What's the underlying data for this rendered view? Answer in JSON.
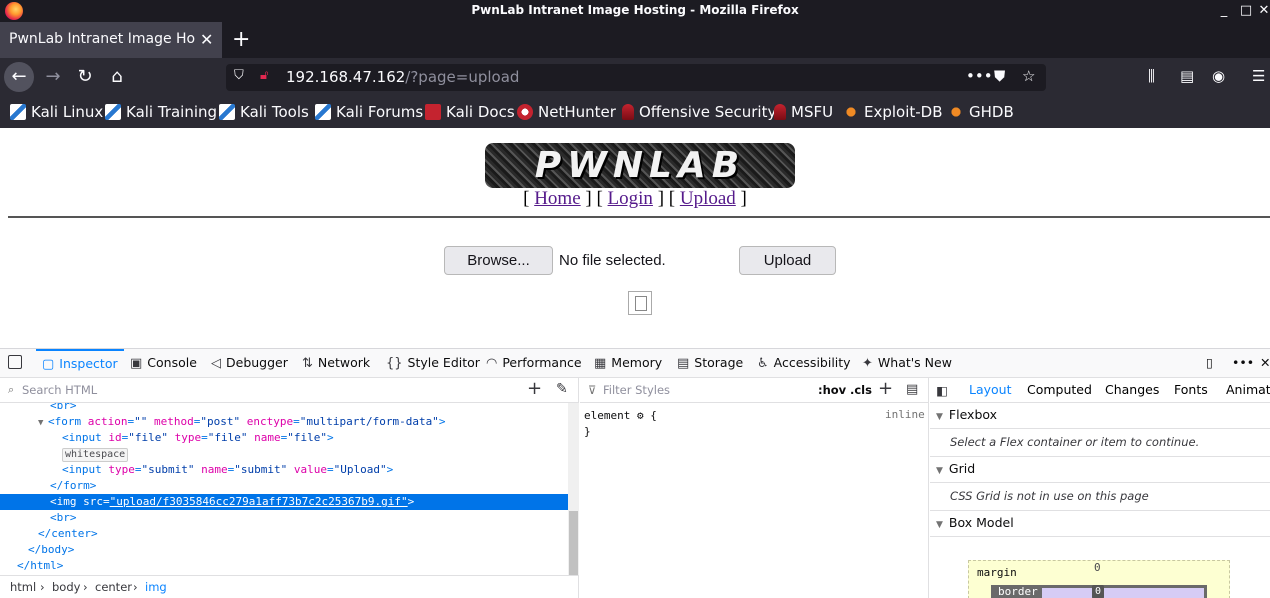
{
  "window": {
    "title": "PwnLab Intranet Image Hosting - Mozilla Firefox",
    "controls": [
      "_",
      "□",
      "✕"
    ]
  },
  "tab": {
    "title": "PwnLab Intranet Image Hosting",
    "close": "✕",
    "new_tab": "+"
  },
  "url": {
    "host": "192.168.47.162",
    "path": "/?page=upload"
  },
  "bookmarks": [
    {
      "label": "Kali Linux",
      "icon": "kali-icon"
    },
    {
      "label": "Kali Training",
      "icon": "kali-icon"
    },
    {
      "label": "Kali Tools",
      "icon": "kali-icon"
    },
    {
      "label": "Kali Forums",
      "icon": "kali-icon"
    },
    {
      "label": "Kali Docs",
      "icon": "kali-docs-icon"
    },
    {
      "label": "NetHunter",
      "icon": "nethunter-icon"
    },
    {
      "label": "Offensive Security",
      "icon": "offsec-icon"
    },
    {
      "label": "MSFU",
      "icon": "offsec-icon"
    },
    {
      "label": "Exploit-DB",
      "icon": "exploitdb-icon"
    },
    {
      "label": "GHDB",
      "icon": "exploitdb-icon"
    }
  ],
  "page": {
    "logo_text": "PWNLAB",
    "nav": {
      "open": "[",
      "sep": "] [",
      "close": "]",
      "home": "Home",
      "login": "Login",
      "upload": "Upload"
    },
    "browse_label": "Browse...",
    "no_file": "No file selected.",
    "upload_label": "Upload"
  },
  "devtools": {
    "tabs": [
      "Inspector",
      "Console",
      "Debugger",
      "Network",
      "Style Editor",
      "Performance",
      "Memory",
      "Storage",
      "Accessibility",
      "What's New"
    ],
    "search_placeholder": "Search HTML",
    "filter_placeholder": "Filter Styles",
    "hov": ":hov",
    "cls": ".cls",
    "tree": {
      "br1": "<br>",
      "form_open_tag": "<form",
      "form_action_attr": "action",
      "form_action_val": "\"\"",
      "form_method_attr": "method",
      "form_method_val": "\"post\"",
      "form_enctype_attr": "enctype",
      "form_enctype_val": "\"multipart/form-data\"",
      "gt": ">",
      "input_tag": "<input",
      "id_attr": "id",
      "id_val": "\"file\"",
      "type_attr": "type",
      "type_file_val": "\"file\"",
      "name_attr": "name",
      "name_file_val": "\"file\"",
      "whitespace": "whitespace",
      "type_submit_val": "\"submit\"",
      "name_submit_val": "\"submit\"",
      "value_attr": "value",
      "value_val": "\"Upload\"",
      "form_close": "</form>",
      "img_tag": "<img",
      "src_attr": "src",
      "src_val": "\"upload/f3035846cc279a1aff73b7c2c25367b9.gif\"",
      "br2": "<br>",
      "center_close": "</center>",
      "body_close": "</body>",
      "html_close": "</html>"
    },
    "breadcrumb": [
      "html",
      "body",
      "center",
      "img"
    ],
    "rules": {
      "selector": "element",
      "open": "{",
      "close": "}",
      "inline": "inline"
    },
    "layout_tabs": [
      "Layout",
      "Computed",
      "Changes",
      "Fonts",
      "Animat"
    ],
    "flexbox_title": "Flexbox",
    "flexbox_msg": "Select a Flex container or item to continue.",
    "grid_title": "Grid",
    "grid_msg": "CSS Grid is not in use on this page",
    "boxmodel_title": "Box Model",
    "margin_label": "margin",
    "margin_value": "0",
    "border_label": "border",
    "border_value": "0"
  }
}
